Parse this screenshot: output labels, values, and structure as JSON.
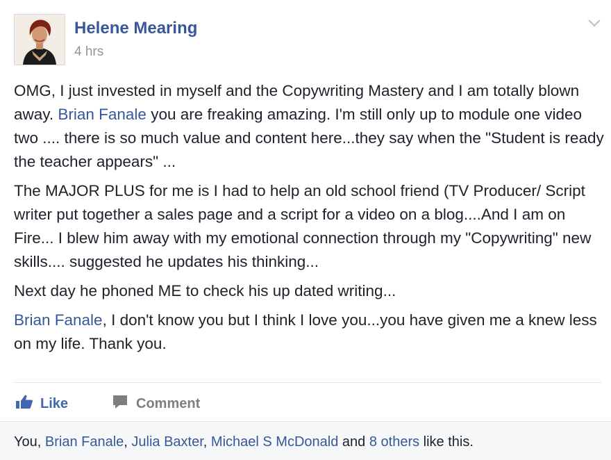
{
  "post": {
    "author": "Helene Mearing",
    "time": "4 hrs",
    "paragraphs": {
      "p1": {
        "before": "OMG, I just invested in myself and the Copywriting Mastery and I am totally blown away. ",
        "mention": "Brian Fanale",
        "after": " you are freaking amazing. I'm still only up to module one video two .... there is so much value and content here...they say when the \"Student is ready the teacher appears\" ..."
      },
      "p2": "The MAJOR PLUS for me is I had to help an old school friend (TV Producer/ Script writer put together a sales page and a script for a video on a blog....And I am on Fire... I blew him away with my emotional connection through my \"Copywriting\" new skills.... suggested he updates his thinking...",
      "p3": "Next day he phoned ME to check his up dated writing...",
      "p4": {
        "mention": "Brian Fanale",
        "after": ", I don't know you but I think I love you...you have given me a knew less on my life. Thank you."
      }
    }
  },
  "actions": {
    "like_label": "Like",
    "comment_label": "Comment"
  },
  "likes": {
    "you": "You,",
    "names": [
      "Brian Fanale",
      "Julia Baxter",
      "Michael S McDonald"
    ],
    "sep": ",",
    "and": "and",
    "others": "8 others",
    "suffix": "like this."
  },
  "icons": {
    "menu": "chevron-down-icon",
    "like": "thumbs-up-icon",
    "comment": "comment-bubble-icon"
  },
  "colors": {
    "link": "#365899",
    "like_accent": "#4267b2",
    "muted": "#90949c",
    "text": "#1d2129"
  }
}
